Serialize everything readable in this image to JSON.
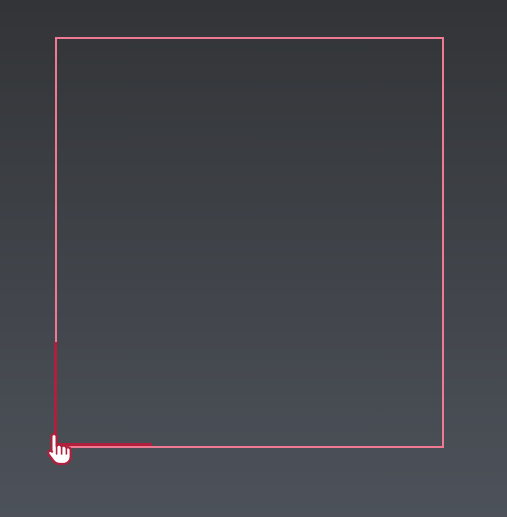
{
  "colors": {
    "bg_top": "#323437",
    "bg_bottom": "#4d525a",
    "rect_border": "#f07a93",
    "accent": "#b0203c",
    "cursor_fill": "#ffffff",
    "cursor_stroke": "#b0203c"
  },
  "cursor": {
    "icon": "hand-pointer-icon"
  }
}
